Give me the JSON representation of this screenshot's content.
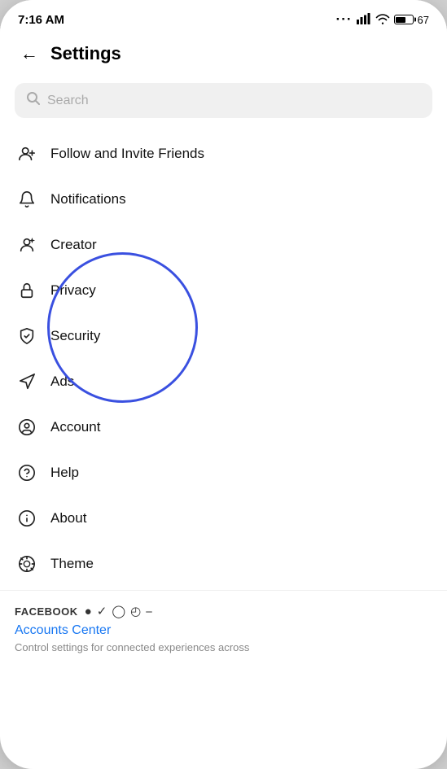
{
  "statusBar": {
    "time": "7:16 AM",
    "battery": "67"
  },
  "header": {
    "title": "Settings",
    "backLabel": "←"
  },
  "search": {
    "placeholder": "Search"
  },
  "menuItems": [
    {
      "id": "follow",
      "label": "Follow and Invite Friends",
      "icon": "follow"
    },
    {
      "id": "notifications",
      "label": "Notifications",
      "icon": "bell"
    },
    {
      "id": "creator",
      "label": "Creator",
      "icon": "creator"
    },
    {
      "id": "privacy",
      "label": "Privacy",
      "icon": "lock"
    },
    {
      "id": "security",
      "label": "Security",
      "icon": "shield"
    },
    {
      "id": "ads",
      "label": "Ads",
      "icon": "ads"
    },
    {
      "id": "account",
      "label": "Account",
      "icon": "account"
    },
    {
      "id": "help",
      "label": "Help",
      "icon": "help"
    },
    {
      "id": "about",
      "label": "About",
      "icon": "info"
    },
    {
      "id": "theme",
      "label": "Theme",
      "icon": "theme"
    }
  ],
  "facebookSection": {
    "brandLabel": "FACEBOOK",
    "accountsCenterLabel": "Accounts Center",
    "accountsCenterDesc": "Control settings for connected experiences across"
  }
}
